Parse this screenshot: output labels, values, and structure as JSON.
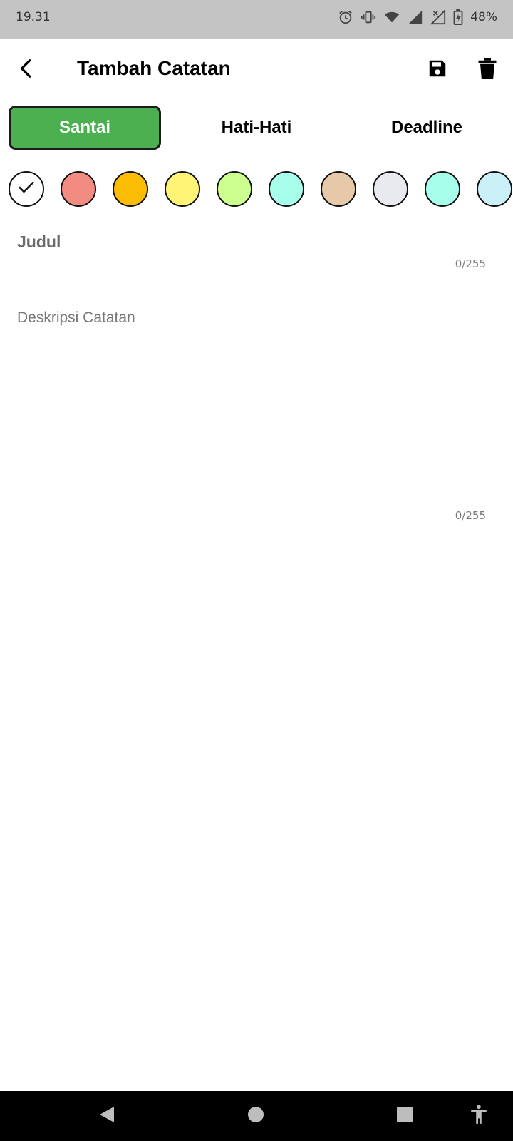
{
  "status_bar": {
    "time": "19.31",
    "battery": "48%",
    "icons": [
      "alarm-icon",
      "vibrate-icon",
      "wifi-icon",
      "signal-icon",
      "no-signal-icon",
      "battery-charging-icon"
    ]
  },
  "app_bar": {
    "title": "Tambah Catatan",
    "icons": [
      "back-arrow-icon",
      "save-icon",
      "delete-icon"
    ]
  },
  "priority_tabs": {
    "selected": "Santai",
    "items": [
      {
        "label": "Santai"
      },
      {
        "label": "Hati-Hati"
      },
      {
        "label": "Deadline"
      }
    ],
    "active_color": "#4caf50"
  },
  "color_swatches": [
    {
      "color": "#ffffff",
      "selected": true
    },
    {
      "color": "#f28b82",
      "selected": false
    },
    {
      "color": "#fbbc04",
      "selected": false
    },
    {
      "color": "#fff475",
      "selected": false
    },
    {
      "color": "#ccff90",
      "selected": false
    },
    {
      "color": "#a7ffeb",
      "selected": false
    },
    {
      "color": "#e6c9a8",
      "selected": false
    },
    {
      "color": "#e8eaed",
      "selected": false
    },
    {
      "color": "#a7ffeb",
      "selected": false
    },
    {
      "color": "#cbf0f8",
      "selected": false
    }
  ],
  "form": {
    "title_placeholder": "Judul",
    "title_counter": "0/255",
    "description_placeholder": "Deskripsi Catatan",
    "description_counter": "0/255"
  },
  "nav_bar": {
    "icons": [
      "back-triangle-icon",
      "home-circle-icon",
      "recents-square-icon",
      "accessibility-icon"
    ]
  }
}
